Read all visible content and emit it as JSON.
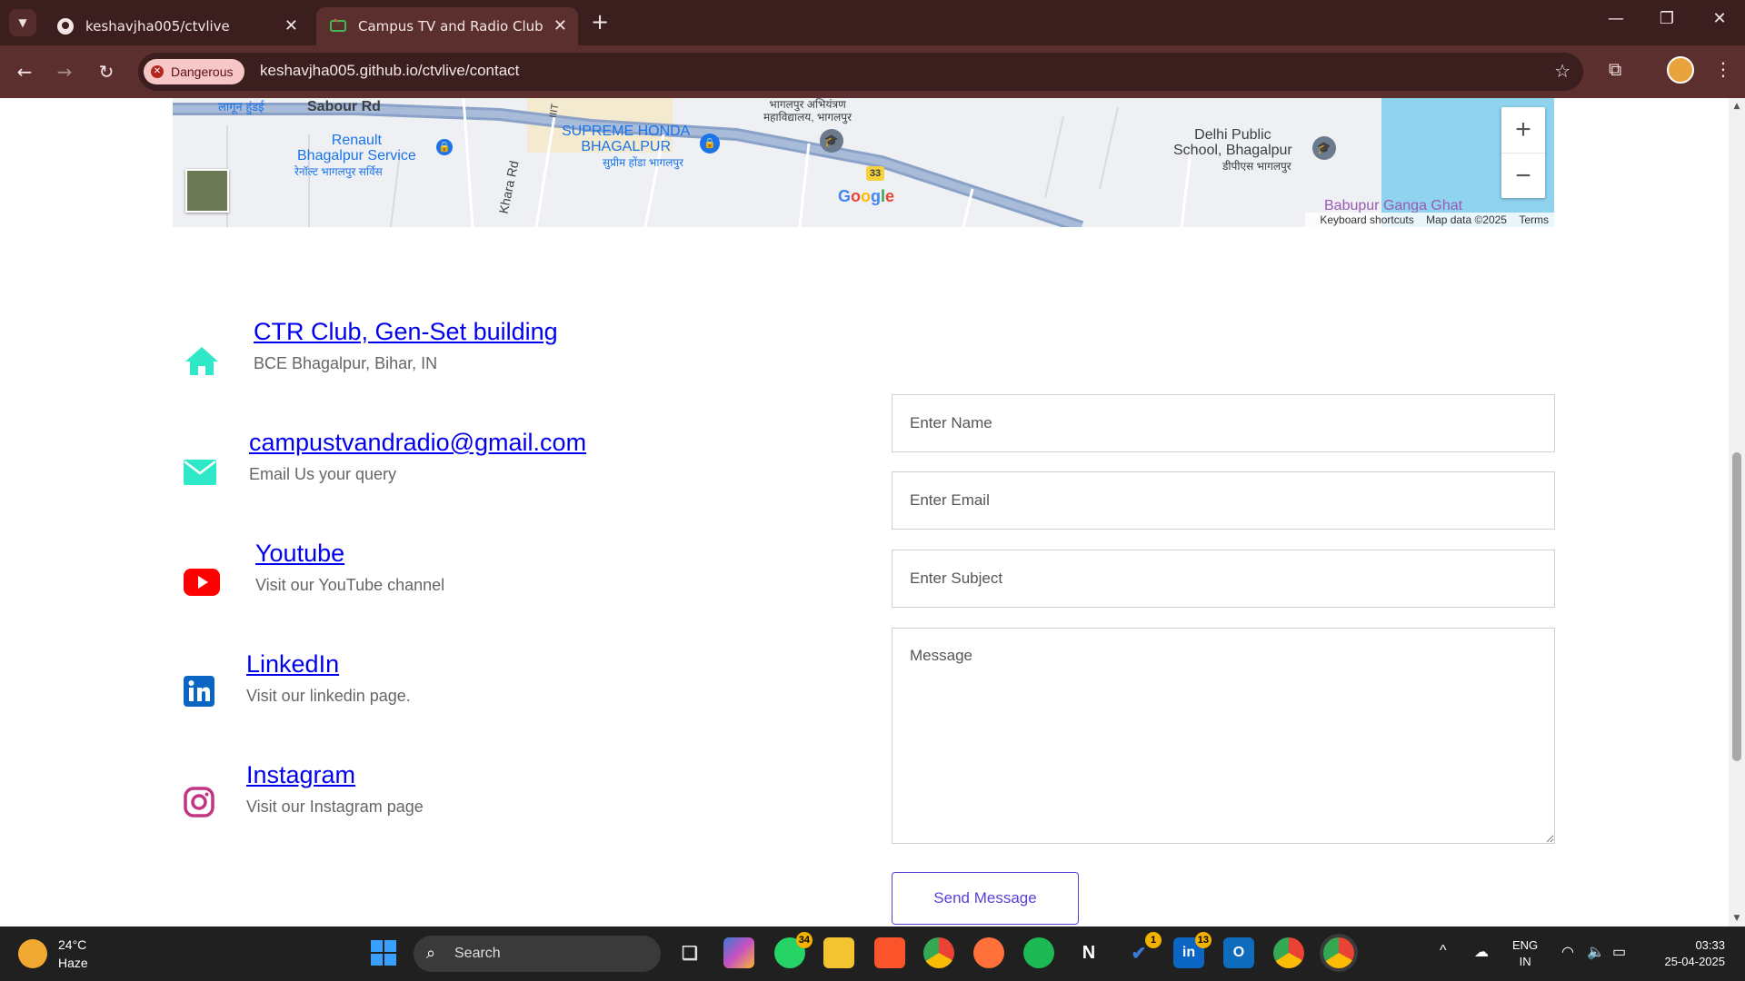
{
  "browser": {
    "tabs": [
      {
        "title": "keshavjha005/ctvlive",
        "icon": "github-icon"
      },
      {
        "title": "Campus TV and Radio Club",
        "icon": "site-icon"
      }
    ],
    "security_label": "Dangerous",
    "url": "keshavjha005.github.io/ctvlive/contact"
  },
  "map": {
    "labels": {
      "sabour_rd": "Sabour Rd",
      "renault": "Renault\nBhagalpur Service",
      "renault_hi": "रेनॉल्ट भागलपुर सर्विस",
      "khara_rd": "Khara Rd",
      "honda": "SUPREME HONDA\nBHAGALPUR",
      "honda_hi": "सुप्रीम होंडा भागलपुर",
      "college_hi": "भागलपुर अभियंत्रण\nमहाविद्यालय, भागलपुर",
      "dps": "Delhi Public\nSchool, Bhagalpur",
      "dps_hi": "डीपीएस भागलपुर",
      "ghat": "Babupur Ganga Ghat",
      "highway": "33",
      "iit": "IIIT",
      "top_hi": "लागून हुंडई"
    },
    "google": "Google",
    "footer": {
      "shortcuts": "Keyboard shortcuts",
      "data": "Map data ©2025",
      "terms": "Terms"
    },
    "zoom_in": "+",
    "zoom_out": "−"
  },
  "contacts": [
    {
      "title": "CTR Club, Gen-Set building",
      "subtitle": "BCE Bhagalpur, Bihar, IN",
      "icon": "home-icon",
      "color": "#2ee8c8"
    },
    {
      "title": "campustvandradio@gmail.com",
      "subtitle": "Email Us your query",
      "icon": "mail-icon",
      "color": "#2ee8c8"
    },
    {
      "title": "Youtube",
      "subtitle": "Visit our YouTube channel",
      "icon": "youtube-icon",
      "color": "#ff0000"
    },
    {
      "title": "LinkedIn",
      "subtitle": "Visit our linkedin page.",
      "icon": "linkedin-icon",
      "color": "#0a66c2"
    },
    {
      "title": "Instagram",
      "subtitle": "Visit our Instagram page",
      "icon": "instagram-icon",
      "color": "#c13584"
    }
  ],
  "form": {
    "name_placeholder": "Enter Name",
    "email_placeholder": "Enter Email",
    "subject_placeholder": "Enter Subject",
    "message_placeholder": "Message",
    "submit_label": "Send Message",
    "accent": "#5b3fd6"
  },
  "taskbar": {
    "temperature": "24°C",
    "weather": "Haze",
    "search_label": "Search",
    "whatsapp_badge": "34",
    "todo_badge": "1",
    "linkedin_badge": "13",
    "language": "ENG",
    "region": "IN",
    "time": "03:33",
    "date": "25-04-2025"
  }
}
